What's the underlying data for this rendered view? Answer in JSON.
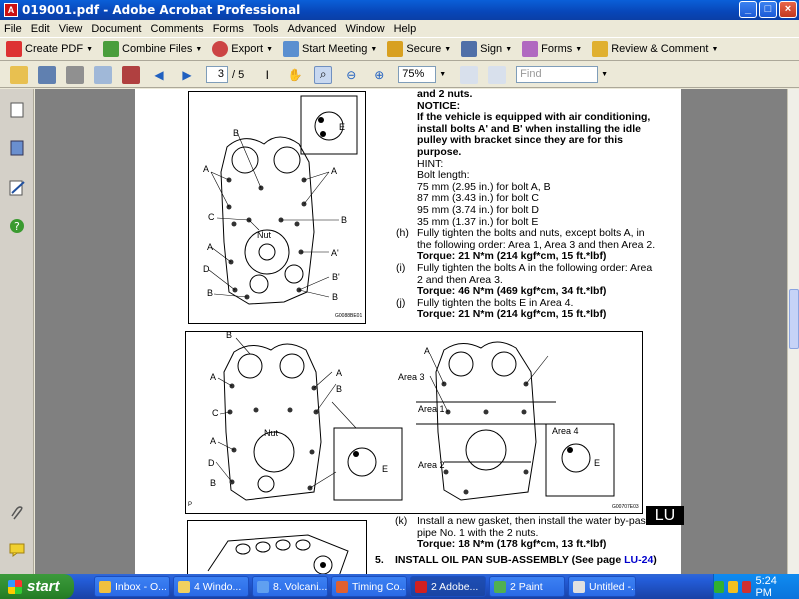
{
  "window": {
    "title": "019001.pdf - Adobe Acrobat Professional"
  },
  "menu": [
    "File",
    "Edit",
    "View",
    "Document",
    "Comments",
    "Forms",
    "Tools",
    "Advanced",
    "Window",
    "Help"
  ],
  "toolbar": {
    "create_pdf": "Create PDF",
    "combine_files": "Combine Files",
    "export": "Export",
    "start_meeting": "Start Meeting",
    "secure": "Secure",
    "sign": "Sign",
    "forms": "Forms",
    "review_comment": "Review & Comment"
  },
  "nav": {
    "page_current": "3",
    "page_total": "/ 5",
    "zoom": "75%",
    "find_placeholder": "Find"
  },
  "document": {
    "top_text": {
      "line1": "and 2 nuts.",
      "notice": "NOTICE:",
      "notice1": "If the vehicle is equipped with air conditioning,",
      "notice2": "install bolts A' and B' when installing the idle",
      "notice3": "pulley with bracket since they are for this",
      "notice4": "purpose.",
      "hint": "HINT:",
      "bolt_length": "Bolt length:",
      "bolt1": "75 mm (2.95 in.) for bolt A, B",
      "bolt2": "87 mm (3.43 in.) for bolt C",
      "bolt3": "95 mm (3.74 in.) for bolt D",
      "bolt4": "35 mm (1.37 in.) for bolt E",
      "h_label": "(h)",
      "h1": "Fully tighten the bolts and nuts, except bolts A, in",
      "h2": "the following order: Area 1, Area 3 and then Area 2.",
      "h_torque": "Torque: 21 N*m (214 kgf*cm, 15 ft.*lbf)",
      "i_label": "(i)",
      "i1": "Fully tighten the bolts A in the following order: Area",
      "i2": "2 and then Area 3.",
      "i_torque": "Torque: 46 N*m (469 kgf*cm, 34 ft.*lbf)",
      "j_label": "(j)",
      "j1": "Fully tighten the bolts E in Area 4.",
      "j_torque": "Torque: 21 N*m (214 kgf*cm, 15 ft.*lbf)"
    },
    "diagram_top": {
      "labels": [
        "B",
        "A",
        "A",
        "C",
        "B",
        "Nut",
        "A",
        "A'",
        "D",
        "B'",
        "B",
        "B",
        "E"
      ],
      "code": "G0088BE01"
    },
    "diagram_mid": {
      "labels": [
        "B",
        "A",
        "A",
        "B",
        "C",
        "Nut",
        "A",
        "D",
        "B",
        "A",
        "Area 3",
        "Area 1",
        "Area 2",
        "Area 4",
        "E",
        "E",
        "P"
      ],
      "code": "G00707E03"
    },
    "bottom_text": {
      "k_label": "(k)",
      "k1": "Install a new gasket, then install the water by-pass",
      "k2": "pipe No. 1 with the 2 nuts.",
      "k_torque": "Torque: 18 N*m (178 kgf*cm, 13 ft.*lbf)",
      "step5_num": "5.",
      "step5": "INSTALL OIL PAN SUB-ASSEMBLY (See page ",
      "step5_link": "LU-24",
      "step5_end": ")"
    },
    "section_tab": "LU"
  },
  "taskbar": {
    "start": "start",
    "tasks": [
      "Inbox - O...",
      "4 Windo...",
      "8. Volcani...",
      "Timing Co...",
      "2 Adobe...",
      "2 Paint",
      "Untitled -..."
    ],
    "active_task": 4,
    "clock": "5:24 PM"
  },
  "colors": {
    "titlebar": "#0a5fd8",
    "taskbar": "#245edb",
    "start": "#2e8b2e",
    "link": "#0000cc"
  }
}
